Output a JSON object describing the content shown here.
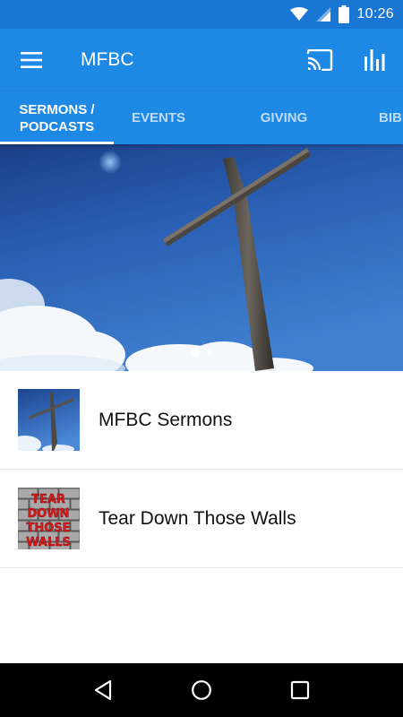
{
  "status_bar": {
    "time": "10:26",
    "icons": [
      "wifi-icon",
      "cell-signal-icon",
      "battery-icon"
    ],
    "background": "#1976d2"
  },
  "app_bar": {
    "title": "MFBC",
    "background": "#1e88e5",
    "icons": [
      "menu-icon",
      "cast-icon",
      "equalizer-icon"
    ]
  },
  "tabs": [
    {
      "line1": "SERMONS /",
      "line2": "PODCASTS",
      "active": true
    },
    {
      "line1": "EVENTS",
      "line2": "",
      "active": false
    },
    {
      "line1": "GIVING",
      "line2": "",
      "active": false
    },
    {
      "line1": "BIBLE",
      "line2": "",
      "active": false
    }
  ],
  "hero": {
    "image": "cross-against-blue-sky",
    "pager": {
      "count": 2,
      "active_index": 0
    }
  },
  "list": {
    "items": [
      {
        "title": "MFBC Sermons",
        "thumbnail": "cross-sky-thumbnail"
      },
      {
        "title": "Tear Down Those Walls",
        "thumbnail": "brick-wall-thumbnail",
        "thumbnail_text": "TEAR DOWN THOSE WALLS"
      }
    ]
  },
  "nav_bar": {
    "icons": [
      "back-icon",
      "home-icon",
      "recents-icon"
    ]
  }
}
